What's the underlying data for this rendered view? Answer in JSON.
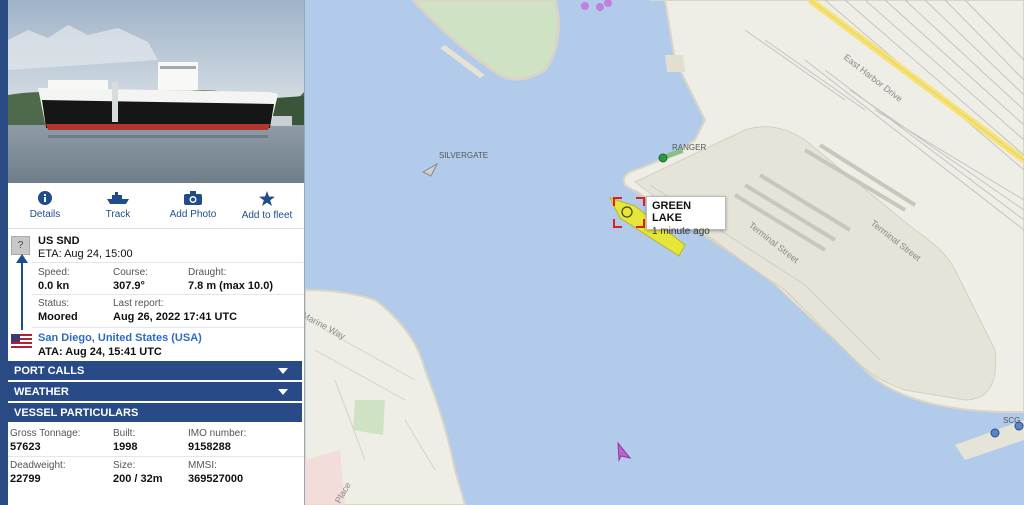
{
  "actions": [
    {
      "label": "Details",
      "icon": "info-icon"
    },
    {
      "label": "Track",
      "icon": "ship-track-icon"
    },
    {
      "label": "Add Photo",
      "icon": "camera-icon"
    },
    {
      "label": "Add to fleet",
      "icon": "star-icon"
    }
  ],
  "voyage": {
    "origin_flag": "?",
    "origin": "US SND",
    "eta": "ETA: Aug 24, 15:00",
    "speed_label": "Speed:",
    "speed": "0.0 kn",
    "course_label": "Course:",
    "course": "307.9°",
    "draught_label": "Draught:",
    "draught": "7.8 m (max 10.0)",
    "status_label": "Status:",
    "status": "Moored",
    "last_report_label": "Last report:",
    "last_report": "Aug 26, 2022 17:41 UTC",
    "destination": "San Diego, United States (USA)",
    "ata": "ATA: Aug 24, 15:41 UTC"
  },
  "sections": {
    "port_calls": "PORT CALLS",
    "weather": "WEATHER",
    "vessel_particulars": "VESSEL PARTICULARS"
  },
  "particulars": {
    "gross_tonnage_label": "Gross Tonnage:",
    "gross_tonnage": "57623",
    "built_label": "Built:",
    "built": "1998",
    "imo_label": "IMO number:",
    "imo": "9158288",
    "deadweight_label": "Deadweight:",
    "deadweight": "22799",
    "size_label": "Size:",
    "size": "200 / 32m",
    "mmsi_label": "MMSI:",
    "mmsi": "369527000"
  },
  "map": {
    "vessel_labels": {
      "silvergate": "SILVERGATE",
      "ranger": "RANGER",
      "scg": "SCG"
    },
    "streets": {
      "east_harbor": "East Harbor Drive",
      "terminal1": "Terminal Street",
      "terminal2": "Terminal Street",
      "marine_way": "Marine Way",
      "place": "Place"
    },
    "tooltip": {
      "name": "GREEN LAKE",
      "time": "1 minute ago"
    },
    "colors": {
      "water": "#b2cbea",
      "land": "#efeee6",
      "park": "#cfe2c3",
      "selected_vessel": "#e6e63a",
      "marker": "#e02020"
    }
  }
}
